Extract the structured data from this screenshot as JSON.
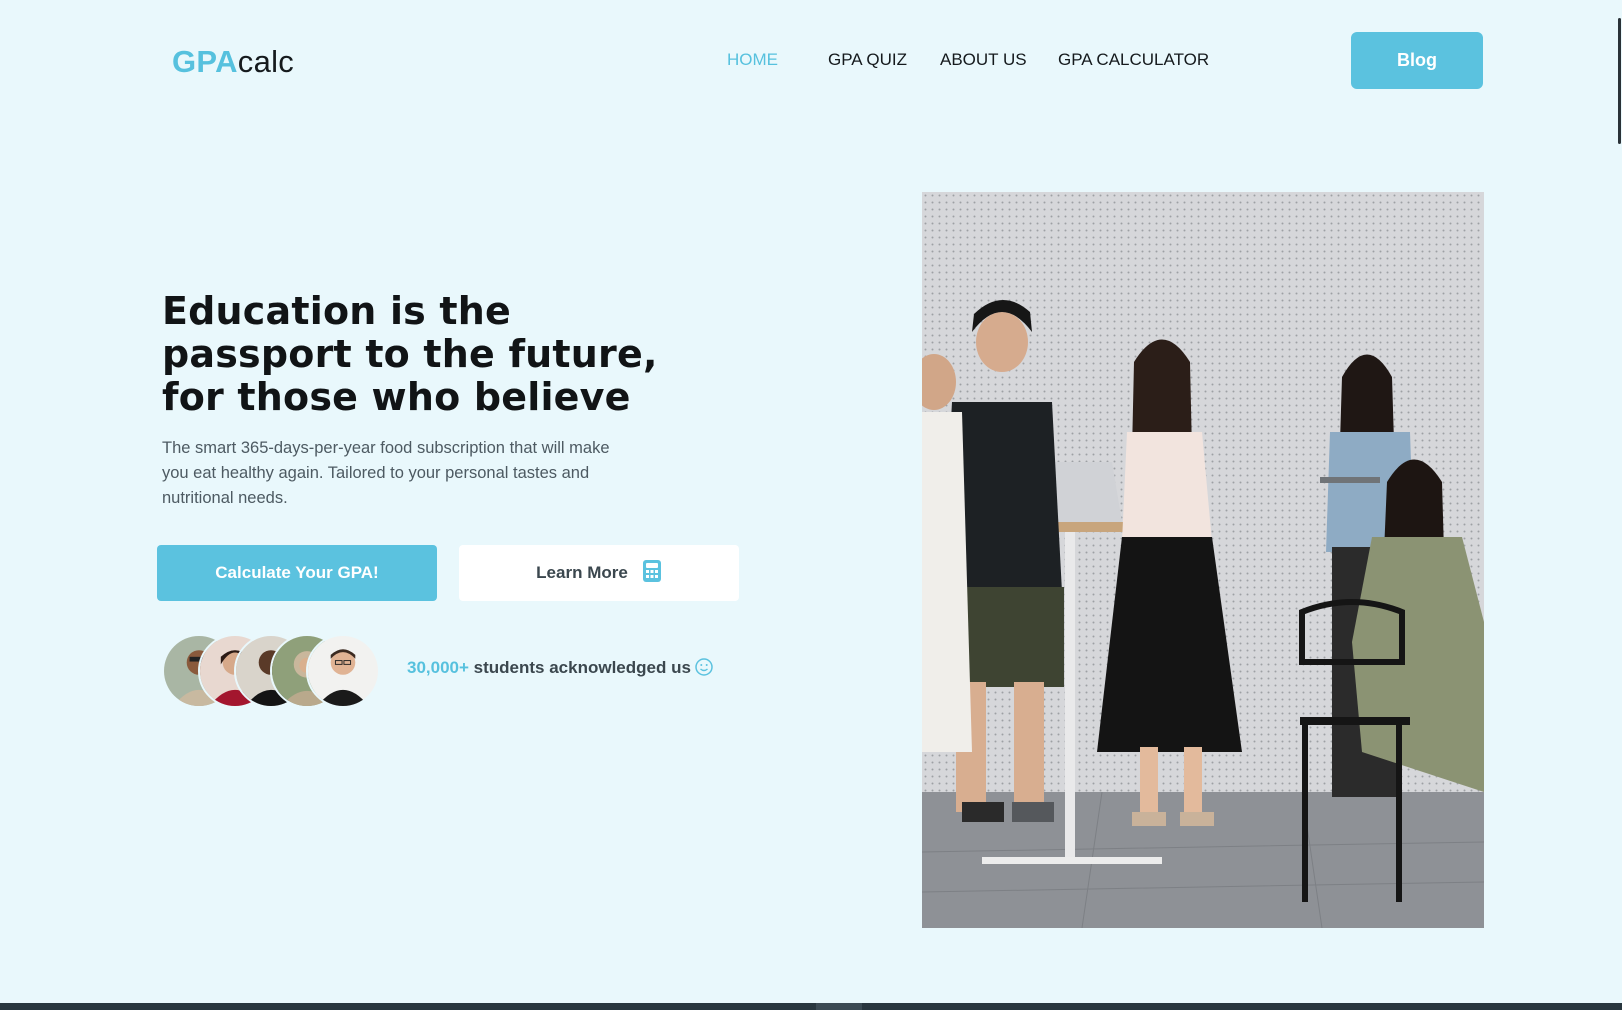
{
  "header": {
    "logo_highlight": "GPA",
    "logo_rest": "calc",
    "nav": [
      "HOME",
      "GPA QUIZ",
      "ABOUT US",
      "GPA CALCULATOR"
    ],
    "active_nav": "HOME",
    "blog_label": "Blog"
  },
  "hero": {
    "title": "Education is the passport to the future, for those who believe",
    "subtitle": "The smart 365-days-per-year food subscription that will make you eat healthy again. Tailored to your personal tastes and nutritional needs.",
    "primary_button": "Calculate Your GPA!",
    "secondary_button": "Learn More",
    "secondary_icon": "calculator-icon",
    "students_count": "30,000+",
    "students_text": " students acknowledged us",
    "students_icon": "smile-icon"
  },
  "colors": {
    "background": "#e9f8fc",
    "accent": "#5bc2df",
    "text": "#151a1d"
  }
}
